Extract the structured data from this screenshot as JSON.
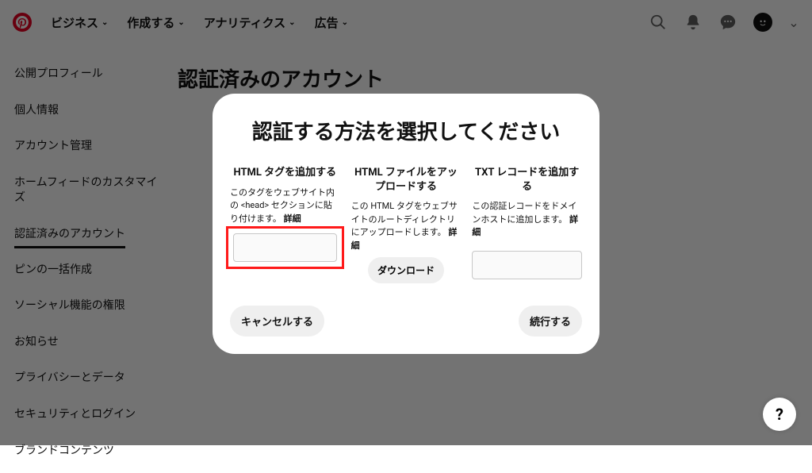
{
  "nav": {
    "items": [
      "ビジネス",
      "作成する",
      "アナリティクス",
      "広告"
    ]
  },
  "sidebar": {
    "items": [
      "公開プロフィール",
      "個人情報",
      "アカウント管理",
      "ホームフィードのカスタマイズ",
      "認証済みのアカウント",
      "ピンの一括作成",
      "ソーシャル機能の権限",
      "お知らせ",
      "プライバシーとデータ",
      "セキュリティとログイン",
      "ブランドコンテンツ"
    ],
    "active_index": 4
  },
  "page": {
    "title": "認証済みのアカウント"
  },
  "modal": {
    "title": "認証する方法を選択してください",
    "options": [
      {
        "title": "HTML タグを追加する",
        "desc": "このタグをウェブサイト内の <head> セクションに貼り付けます。",
        "detail": "詳細"
      },
      {
        "title": "HTML ファイルをアップロードする",
        "desc": "この HTML タグをウェブサイトのルートディレクトリにアップロードします。",
        "detail": "詳細",
        "download": "ダウンロード"
      },
      {
        "title": "TXT レコードを追加する",
        "desc": "この認証レコードをドメインホストに追加します。",
        "detail": "詳細"
      }
    ],
    "cancel": "キャンセルする",
    "continue": "続行する"
  },
  "help": {
    "label": "?"
  }
}
